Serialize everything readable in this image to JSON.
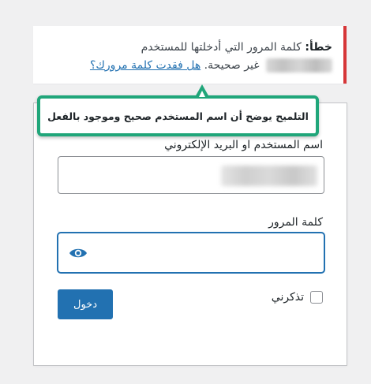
{
  "notice": {
    "error_label": "خطأ:",
    "message_part1": "كلمة المرور التي أدخلتها للمستخدم",
    "message_part2": "غير صحيحة.",
    "lost_password_link": "هل فقدت كلمة مرورك؟"
  },
  "tooltip": {
    "text": "التلميح يوضح أن اسم المستخدم صحيح وموجود بالفعل"
  },
  "form": {
    "username_label": "اسم المستخدم او البريد الإلكتروني",
    "password_label": "كلمة المرور",
    "remember_label": "تذكرني",
    "login_button": "دخول"
  },
  "colors": {
    "error_border": "#d63638",
    "primary": "#2271b1",
    "tooltip_border": "#20a67a"
  },
  "icons": {
    "show_password": "eye-icon"
  }
}
